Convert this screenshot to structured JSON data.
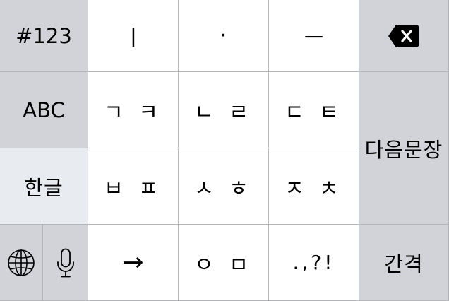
{
  "keyboard": {
    "row1": {
      "mode_numbers": "#123",
      "vowel_i": "ㅣ",
      "vowel_dot": "·",
      "vowel_eu": "ㅡ",
      "delete_icon": "backspace-icon"
    },
    "row2": {
      "mode_abc": "ABC",
      "giyeok_kieuk": "ㄱ ㅋ",
      "nieun_rieul": "ㄴ ㄹ",
      "digeut_tieut": "ㄷ ㅌ",
      "next_sentence": "다음문장"
    },
    "row3": {
      "mode_hangul": "한글",
      "bieup_pieup": "ㅂ ㅍ",
      "siot_hieut": "ㅅ ㅎ",
      "jieut_chieut": "ㅈ ㅊ"
    },
    "row4": {
      "globe_icon": "globe-icon",
      "mic_icon": "microphone-icon",
      "arrow": "→",
      "ieung_mieum": "ㅇ ㅁ",
      "punctuation": ".,?!",
      "space": "간격"
    }
  },
  "colors": {
    "function_key": "#d1d3d9",
    "letter_key": "#ffffff",
    "active_mode_key": "#e8ebef",
    "divider": "#b4b6ba"
  }
}
